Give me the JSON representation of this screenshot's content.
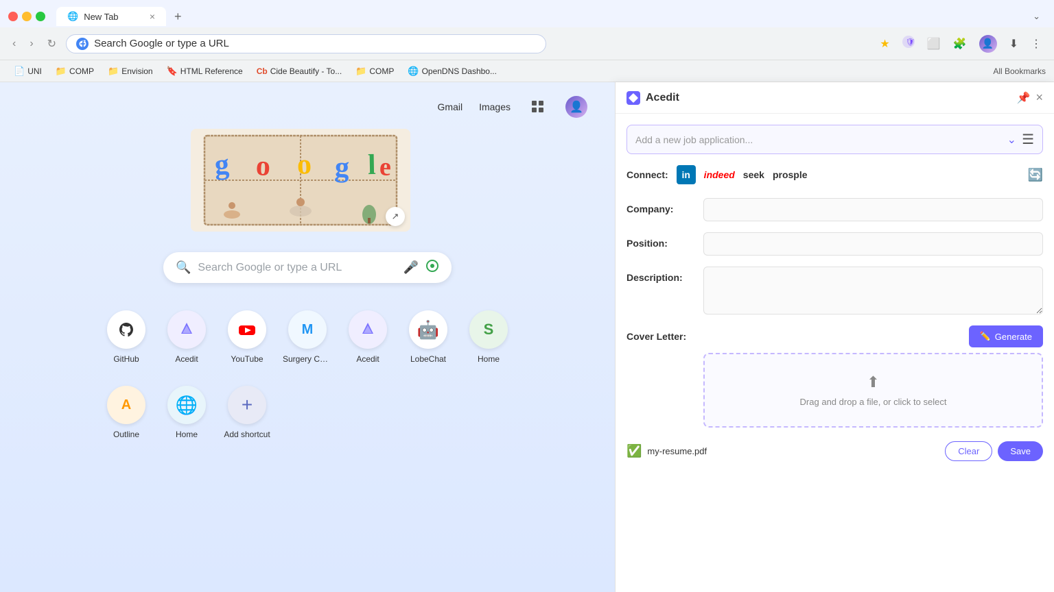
{
  "browser": {
    "tab": {
      "title": "New Tab",
      "favicon": "🌐"
    },
    "address_bar": {
      "url": "Search Google or type a URL",
      "placeholder": "Search Google or type a URL"
    },
    "toolbar_buttons": {
      "back": "‹",
      "forward": "›",
      "refresh": "↻",
      "star": "☆",
      "extensions": "🧩",
      "screenshot": "⬜",
      "puzzle": "🧩",
      "download": "⬇",
      "more": "⋮",
      "expand": "⌄"
    },
    "bookmarks": [
      {
        "label": "UNI",
        "icon": "📄"
      },
      {
        "label": "COMP",
        "icon": "📁"
      },
      {
        "label": "Envision",
        "icon": "📁"
      },
      {
        "label": "HTML Reference",
        "icon": "🔖"
      },
      {
        "label": "Cide Beautify - To...",
        "icon": "Cb"
      },
      {
        "label": "COMP",
        "icon": "📁"
      },
      {
        "label": "OpenDNS Dashbo...",
        "icon": "🌐"
      }
    ],
    "bookmarks_right": "All Bookmarks"
  },
  "new_tab": {
    "top_links": [
      {
        "label": "Gmail"
      },
      {
        "label": "Images"
      }
    ],
    "search_placeholder": "Search Google or type a URL",
    "shortcuts": [
      {
        "id": "github",
        "label": "GitHub",
        "icon": "🐙",
        "color": "#fff"
      },
      {
        "id": "acedit",
        "label": "Acedit",
        "icon": "💜",
        "color": "#f0eeff"
      },
      {
        "id": "youtube",
        "label": "YouTube",
        "icon": "▶",
        "color": "#fff"
      },
      {
        "id": "surgery",
        "label": "Surgery Con...",
        "icon": "M",
        "color": "#fff"
      },
      {
        "id": "acedit2",
        "label": "Acedit",
        "icon": "💎",
        "color": "#f0eeff"
      },
      {
        "id": "lobechat",
        "label": "LobeChat",
        "icon": "🤖",
        "color": "#fff"
      },
      {
        "id": "home-s",
        "label": "Home",
        "icon": "S",
        "color": "#e8f5e9"
      },
      {
        "id": "outline",
        "label": "Outline",
        "icon": "A",
        "color": "#fff"
      },
      {
        "id": "home-e",
        "label": "Home",
        "icon": "E",
        "color": "#e8f5fb"
      },
      {
        "id": "add",
        "label": "Add shortcut",
        "icon": "+",
        "color": "#e8eaf6"
      }
    ]
  },
  "panel": {
    "title": "Acedit",
    "dropdown_placeholder": "Add a new job application...",
    "connect_label": "Connect:",
    "connect_sources": [
      {
        "id": "linkedin",
        "label": "in"
      },
      {
        "id": "indeed",
        "label": "indeed"
      },
      {
        "id": "seek",
        "label": "seek"
      },
      {
        "id": "prosple",
        "label": "prosple"
      }
    ],
    "fields": {
      "company_label": "Company:",
      "position_label": "Position:",
      "description_label": "Description:",
      "cover_letter_label": "Cover Letter:"
    },
    "generate_btn": "Generate",
    "drop_zone_text": "Drag and drop a file, or click to select",
    "resume": {
      "filename": "my-resume.pdf",
      "status": "✓"
    },
    "buttons": {
      "clear": "Clear",
      "save": "Save"
    }
  }
}
